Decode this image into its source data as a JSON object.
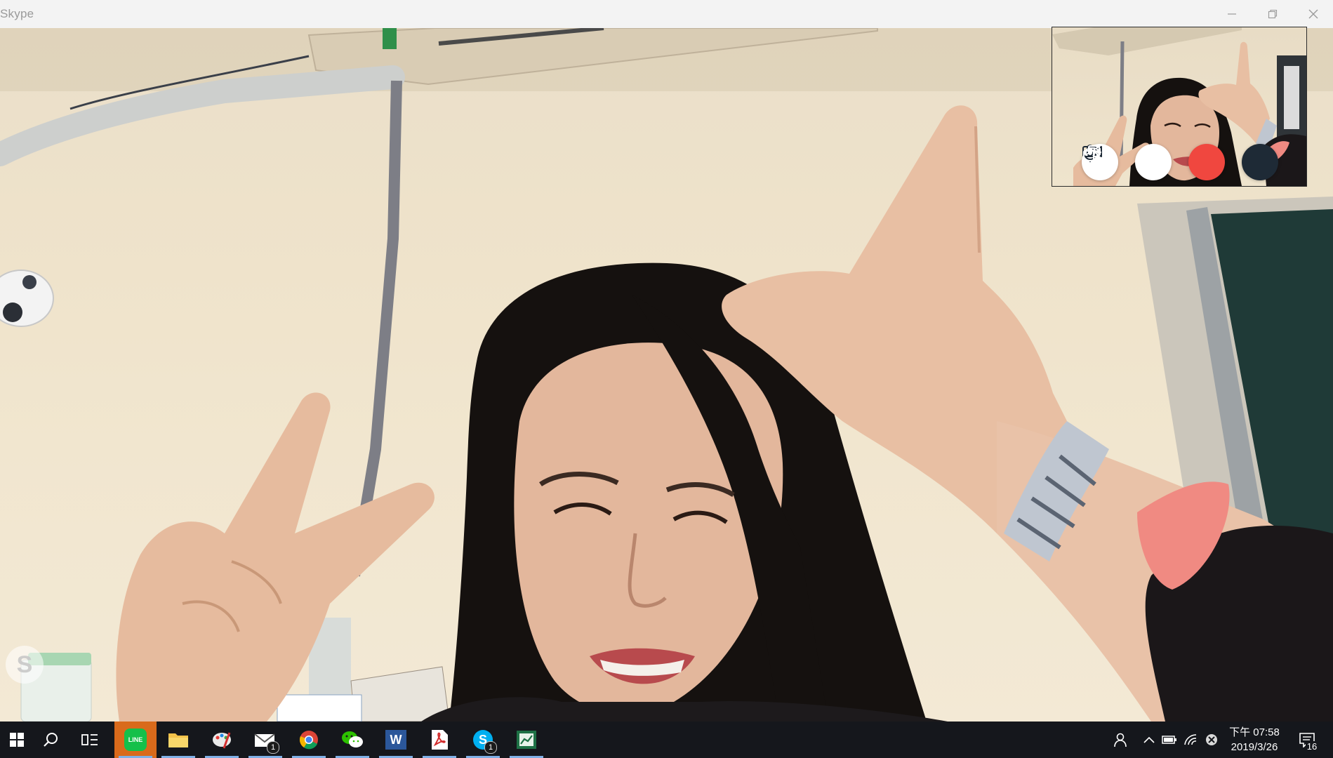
{
  "window": {
    "app_title": "Skype",
    "controls": [
      "minimize",
      "maximize",
      "close"
    ]
  },
  "call": {
    "remote_watermark": "S",
    "controls": [
      {
        "name": "mute-mic",
        "icon": "microphone-icon"
      },
      {
        "name": "toggle-video",
        "icon": "video-camera-icon"
      },
      {
        "name": "end-call",
        "icon": "hangup-icon",
        "color": "#f0473f"
      },
      {
        "name": "switch-view",
        "icon": "window-switch-icon"
      }
    ]
  },
  "taskbar": {
    "items": [
      {
        "name": "line",
        "label": "LINE",
        "active": true,
        "badge": null
      },
      {
        "name": "file-explorer",
        "badge": null
      },
      {
        "name": "paint",
        "badge": null
      },
      {
        "name": "mail",
        "badge": "1"
      },
      {
        "name": "chrome",
        "badge": null
      },
      {
        "name": "wechat",
        "badge": null
      },
      {
        "name": "word",
        "label": "W",
        "badge": null
      },
      {
        "name": "acrobat",
        "badge": null
      },
      {
        "name": "skype",
        "label": "S",
        "badge": "1"
      },
      {
        "name": "excel",
        "badge": null
      }
    ],
    "clock_time": "下午 07:58",
    "clock_date": "2019/3/26",
    "notification_count": "16",
    "accent": "#d96a1b"
  }
}
